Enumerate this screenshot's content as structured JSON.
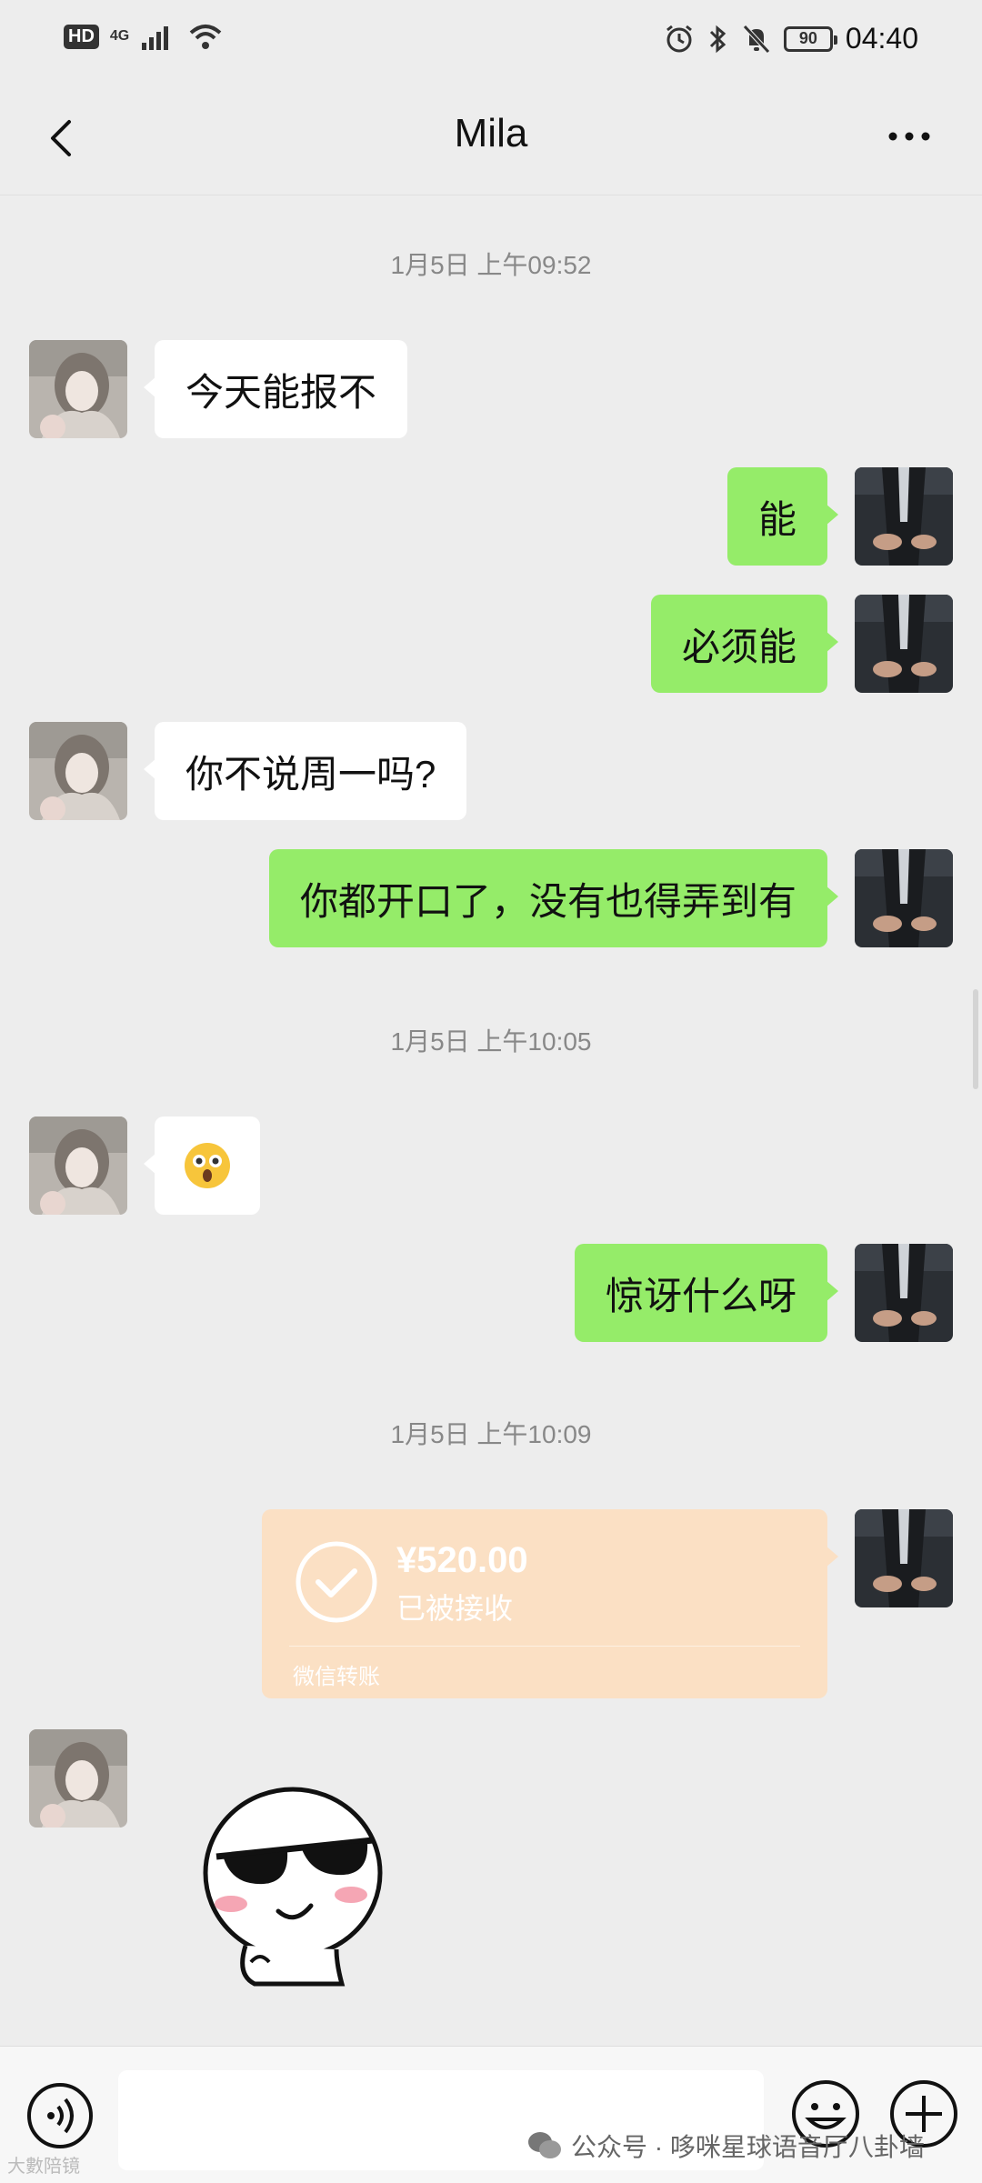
{
  "status_bar": {
    "hd": "HD",
    "network": "4G",
    "battery": "90",
    "time": "04:40"
  },
  "nav": {
    "title": "Mila"
  },
  "timestamps": [
    "1月5日 上午09:52",
    "1月5日 上午10:05",
    "1月5日 上午10:09"
  ],
  "messages": [
    {
      "side": "left",
      "text": "今天能报不"
    },
    {
      "side": "right",
      "text": "能"
    },
    {
      "side": "right",
      "text": "必须能"
    },
    {
      "side": "left",
      "text": "你不说周一吗?"
    },
    {
      "side": "right",
      "text": "你都开口了，没有也得弄到有"
    },
    {
      "side": "left",
      "text": "",
      "emoji": "surprised-emoji"
    },
    {
      "side": "right",
      "text": "惊讶什么呀"
    }
  ],
  "transfer": {
    "amount": "¥520.00",
    "status": "已被接收",
    "label": "微信转账",
    "color": "#fbe0c4"
  },
  "sticker": "cool-sunglasses-sticker",
  "watermark": {
    "text": "公众号 · 哆咪星球语音厅八卦墙",
    "corner": "大數陪镜"
  },
  "colors": {
    "background": "#ededed",
    "bubble_self": "#95ec69",
    "bubble_other": "#ffffff"
  }
}
